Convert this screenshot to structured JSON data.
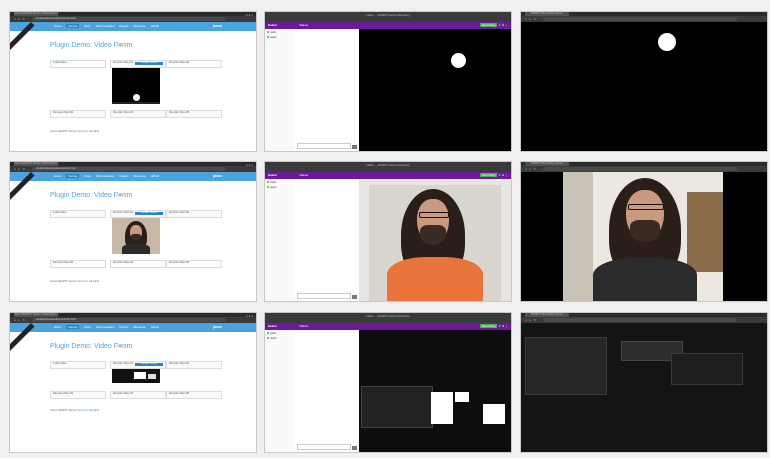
{
  "browser": {
    "janus_tab": "Janus WebRTC Server: Video Room Demo",
    "janus_url": "localhost/janus/videoroomtest.html",
    "chat_window": "Hakon — WebRTC Server Recording",
    "popup_tab": "WebRTC Recording Viewer"
  },
  "janus": {
    "nav": [
      "Home",
      "Demos",
      "Docs",
      "Documentation",
      "Papers",
      "Discourse",
      "Github"
    ],
    "active_nav": "Demos",
    "logo": "janus",
    "title": "Plugin Demo: Video Room",
    "badge": "Stop",
    "local_label": "Local Video",
    "remote_label": "Remote Video #1",
    "remote_button": "Publisher: 1234567",
    "remote2": "Remote Video #2",
    "remote3": "Remote Video #3",
    "remote4": "Remote Video #4",
    "remote5": "Remote Video #5",
    "footer_prefix": "Janus WebRTC Server",
    "footer_link": "Meetecho",
    "footer_suffix": "all rights"
  },
  "chat": {
    "app_name": "Hakon",
    "room": "Videos",
    "actions": [
      "Recording",
      "Share",
      "Leave",
      "Menu"
    ],
    "users": [
      "user1",
      "user2"
    ]
  },
  "colors": {
    "janus_blue": "#4aa3df",
    "app_purple": "#6a1b9a",
    "online": "#4caf50"
  }
}
